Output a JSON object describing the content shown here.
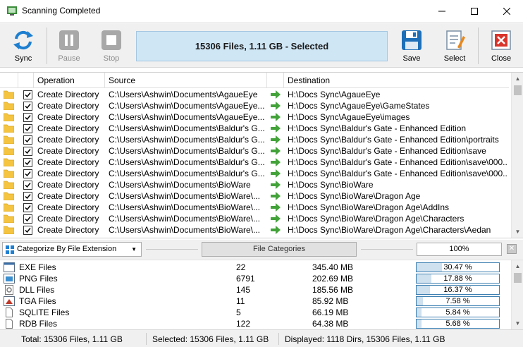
{
  "window": {
    "title": "Scanning Completed"
  },
  "toolbar": {
    "sync": "Sync",
    "pause": "Pause",
    "stop": "Stop",
    "status": "15306 Files, 1.11 GB - Selected",
    "save": "Save",
    "select": "Select",
    "close": "Close"
  },
  "columns": {
    "operation": "Operation",
    "source": "Source",
    "destination": "Destination"
  },
  "rows": [
    {
      "operation": "Create Directory",
      "source": "C:\\Users\\Ashwin\\Documents\\AgaueEye",
      "destination": "H:\\Docs Sync\\AgaueEye"
    },
    {
      "operation": "Create Directory",
      "source": "C:\\Users\\Ashwin\\Documents\\AgaueEye...",
      "destination": "H:\\Docs Sync\\AgaueEye\\GameStates"
    },
    {
      "operation": "Create Directory",
      "source": "C:\\Users\\Ashwin\\Documents\\AgaueEye...",
      "destination": "H:\\Docs Sync\\AgaueEye\\images"
    },
    {
      "operation": "Create Directory",
      "source": "C:\\Users\\Ashwin\\Documents\\Baldur's G...",
      "destination": "H:\\Docs Sync\\Baldur's Gate - Enhanced Edition"
    },
    {
      "operation": "Create Directory",
      "source": "C:\\Users\\Ashwin\\Documents\\Baldur's G...",
      "destination": "H:\\Docs Sync\\Baldur's Gate - Enhanced Edition\\portraits"
    },
    {
      "operation": "Create Directory",
      "source": "C:\\Users\\Ashwin\\Documents\\Baldur's G...",
      "destination": "H:\\Docs Sync\\Baldur's Gate - Enhanced Edition\\save"
    },
    {
      "operation": "Create Directory",
      "source": "C:\\Users\\Ashwin\\Documents\\Baldur's G...",
      "destination": "H:\\Docs Sync\\Baldur's Gate - Enhanced Edition\\save\\000..."
    },
    {
      "operation": "Create Directory",
      "source": "C:\\Users\\Ashwin\\Documents\\Baldur's G...",
      "destination": "H:\\Docs Sync\\Baldur's Gate - Enhanced Edition\\save\\000..."
    },
    {
      "operation": "Create Directory",
      "source": "C:\\Users\\Ashwin\\Documents\\BioWare",
      "destination": "H:\\Docs Sync\\BioWare"
    },
    {
      "operation": "Create Directory",
      "source": "C:\\Users\\Ashwin\\Documents\\BioWare\\...",
      "destination": "H:\\Docs Sync\\BioWare\\Dragon Age"
    },
    {
      "operation": "Create Directory",
      "source": "C:\\Users\\Ashwin\\Documents\\BioWare\\...",
      "destination": "H:\\Docs Sync\\BioWare\\Dragon Age\\AddIns"
    },
    {
      "operation": "Create Directory",
      "source": "C:\\Users\\Ashwin\\Documents\\BioWare\\...",
      "destination": "H:\\Docs Sync\\BioWare\\Dragon Age\\Characters"
    },
    {
      "operation": "Create Directory",
      "source": "C:\\Users\\Ashwin\\Documents\\BioWare\\...",
      "destination": "H:\\Docs Sync\\BioWare\\Dragon Age\\Characters\\Aedan"
    }
  ],
  "categories_bar": {
    "select_value": "Categorize By File Extension",
    "label": "File Categories",
    "percent": "100%"
  },
  "categories": [
    {
      "name": "EXE Files",
      "count": "22",
      "size": "345.40 MB",
      "percent": "30.47 %",
      "fraction": 0.3047,
      "icon": "exe-file-icon"
    },
    {
      "name": "PNG Files",
      "count": "6791",
      "size": "202.69 MB",
      "percent": "17.88 %",
      "fraction": 0.1788,
      "icon": "image-file-icon"
    },
    {
      "name": "DLL Files",
      "count": "145",
      "size": "185.56 MB",
      "percent": "16.37 %",
      "fraction": 0.1637,
      "icon": "dll-file-icon"
    },
    {
      "name": "TGA Files",
      "count": "11",
      "size": "85.92 MB",
      "percent": "7.58 %",
      "fraction": 0.0758,
      "icon": "tga-file-icon"
    },
    {
      "name": "SQLITE Files",
      "count": "5",
      "size": "66.19 MB",
      "percent": "5.84 %",
      "fraction": 0.0584,
      "icon": "file-icon"
    },
    {
      "name": "RDB Files",
      "count": "122",
      "size": "64.38 MB",
      "percent": "5.68 %",
      "fraction": 0.0568,
      "icon": "file-icon"
    }
  ],
  "statusbar": {
    "total": "Total: 15306 Files, 1.11 GB",
    "selected": "Selected: 15306 Files, 1.11 GB",
    "displayed": "Displayed: 1118 Dirs, 15306 Files, 1.11 GB"
  },
  "colors": {
    "accent": "#1e7fd0",
    "status_bg": "#cfe6f5",
    "folder": "#f5c542",
    "arrow": "#43a33a"
  }
}
